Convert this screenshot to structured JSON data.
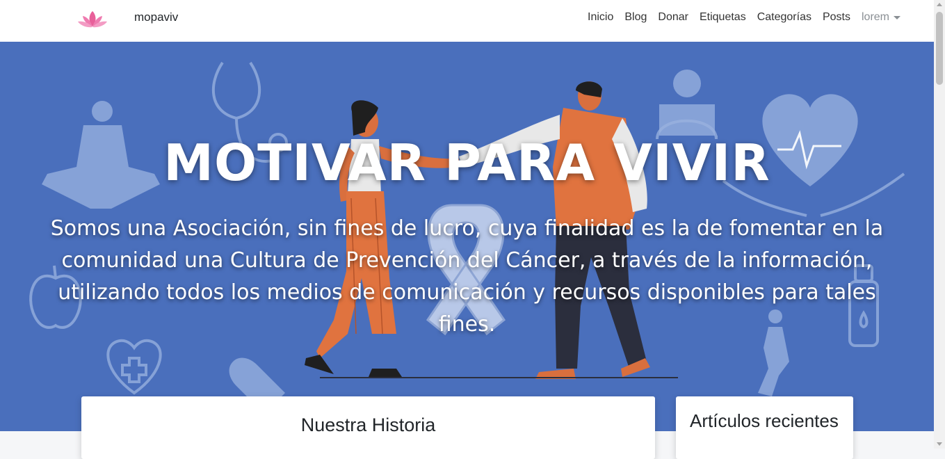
{
  "navbar": {
    "brand": "mopaviv",
    "logo_icon": "lotus-icon",
    "items": [
      {
        "label": "Inicio"
      },
      {
        "label": "Blog"
      },
      {
        "label": "Donar"
      },
      {
        "label": "Etiquetas"
      },
      {
        "label": "Categorías"
      },
      {
        "label": "Posts"
      }
    ],
    "user_menu": "lorem"
  },
  "hero": {
    "title": "MOTIVAR PARA VIVIR",
    "text": "Somos una Asociación, sin fines de lucro, cuya finalidad es la de fomentar en la comunidad una Cultura de Prevención del Cáncer, a través de la información, utilizando todos los medios de comunicación y recursos disponibles para tales fines.",
    "background_color": "#4a6fbc"
  },
  "cards": {
    "main_title": "Nuestra Historia",
    "side_title": "Artículos recientes"
  },
  "colors": {
    "accent_orange": "#e0733f",
    "lotus_pink": "#e8609a"
  }
}
